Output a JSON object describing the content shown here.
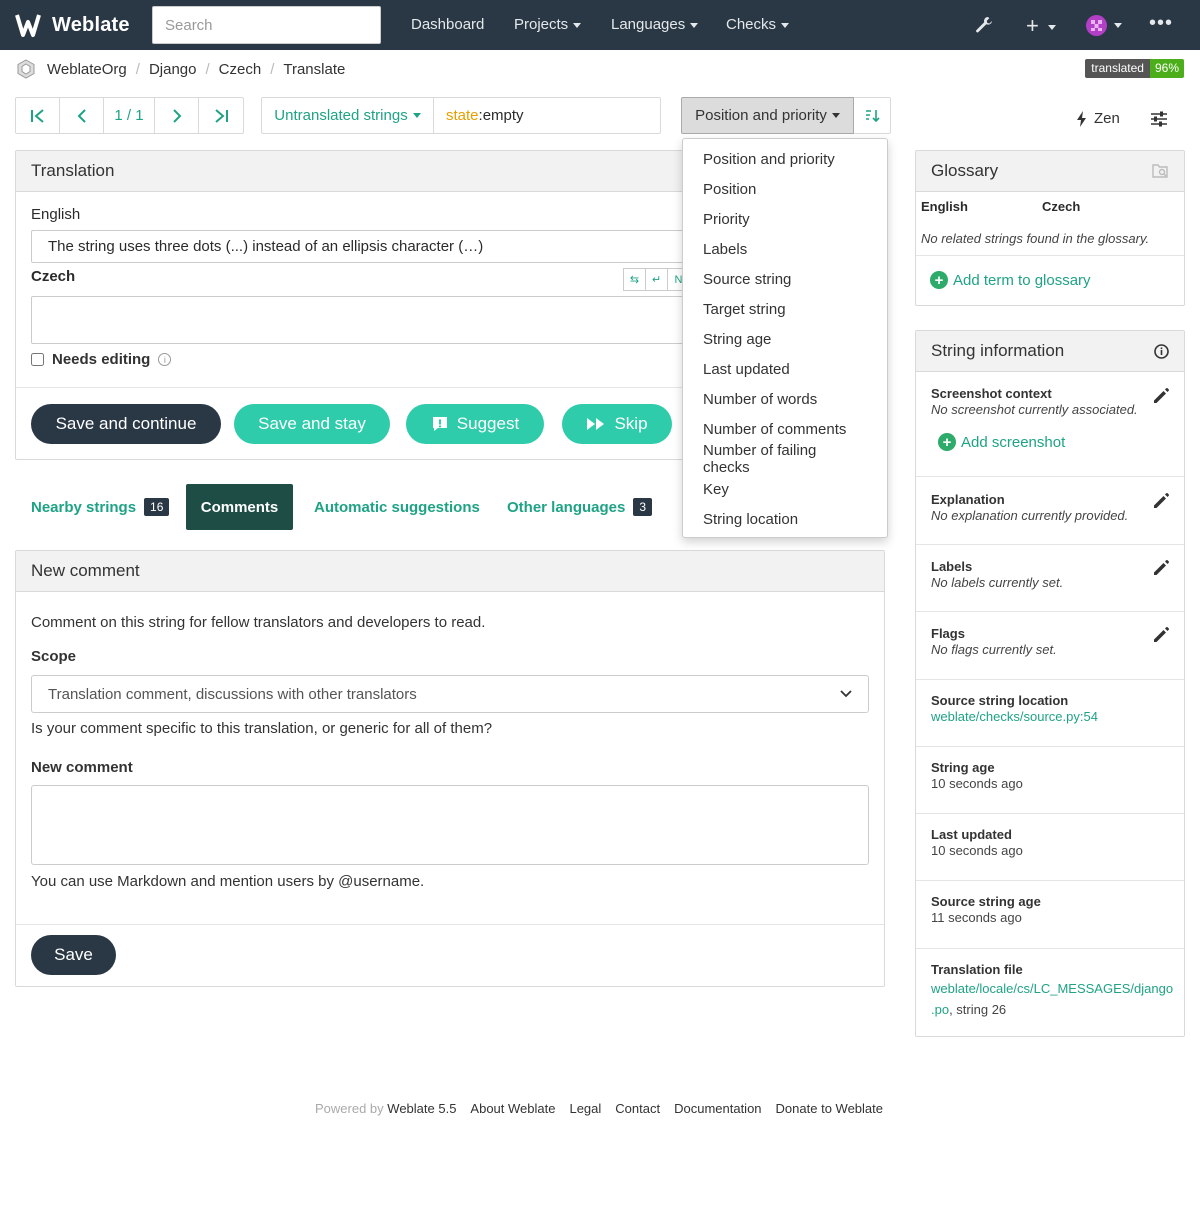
{
  "navbar": {
    "brand": "Weblate",
    "search_placeholder": "Search",
    "links": [
      "Dashboard",
      "Projects",
      "Languages",
      "Checks"
    ]
  },
  "breadcrumb": [
    "WeblateOrg",
    "Django",
    "Czech",
    "Translate"
  ],
  "badge": {
    "label": "translated",
    "value": "96%"
  },
  "pager": {
    "count": "1 / 1"
  },
  "filter": {
    "label": "Untranslated strings",
    "query_key": "state",
    "query_value": ":empty"
  },
  "sort": {
    "label": "Position and priority"
  },
  "zen_label": "Zen",
  "translation": {
    "title": "Translation",
    "source_lang": "English",
    "source_text": "The string uses three dots (...) instead of an ellipsis character (…)",
    "target_lang": "Czech",
    "tool_n": "N",
    "needs_editing": "Needs editing",
    "buttons": {
      "save_continue": "Save and continue",
      "save_stay": "Save and stay",
      "suggest": "Suggest",
      "skip": "Skip"
    }
  },
  "tabs": [
    {
      "label": "Nearby strings",
      "count": "16"
    },
    {
      "label": "Comments"
    },
    {
      "label": "Automatic suggestions"
    },
    {
      "label": "Other languages",
      "count": "3"
    }
  ],
  "comment": {
    "title": "New comment",
    "intro": "Comment on this string for fellow translators and developers to read.",
    "scope_label": "Scope",
    "scope_value": "Translation comment, discussions with other translators",
    "scope_help": "Is your comment specific to this translation, or generic for all of them?",
    "comment_label": "New comment",
    "markdown_help": "You can use Markdown and mention users by @username.",
    "save": "Save"
  },
  "sort_menu": [
    "Position and priority",
    "Position",
    "Priority",
    "Labels",
    "Source string",
    "Target string",
    "String age",
    "Last updated",
    "Number of words",
    "Number of comments",
    "Number of failing checks",
    "Key",
    "String location"
  ],
  "glossary": {
    "title": "Glossary",
    "col_source": "English",
    "col_target": "Czech",
    "empty": "No related strings found in the glossary.",
    "add": "Add term to glossary"
  },
  "string_info": {
    "title": "String information",
    "screenshot_title": "Screenshot context",
    "screenshot_value": "No screenshot currently associated.",
    "add_screenshot": "Add screenshot",
    "explanation_title": "Explanation",
    "explanation_value": "No explanation currently provided.",
    "labels_title": "Labels",
    "labels_value": "No labels currently set.",
    "flags_title": "Flags",
    "flags_value": "No flags currently set.",
    "location_title": "Source string location",
    "location_value": "weblate/checks/source.py:54",
    "age_title": "String age",
    "age_value": "10 seconds ago",
    "updated_title": "Last updated",
    "updated_value": "10 seconds ago",
    "source_age_title": "Source string age",
    "source_age_value": "11 seconds ago",
    "file_title": "Translation file",
    "file_link_1": "weblate/locale/cs/LC_MESSAGES/django",
    "file_link_2": ".po",
    "file_suffix": ", string 26"
  },
  "footer": {
    "powered_by": "Powered by",
    "version": "Weblate 5.5",
    "links": [
      "About Weblate",
      "Legal",
      "Contact",
      "Documentation",
      "Donate to Weblate"
    ]
  },
  "colors": {
    "navbar": "#2a3744",
    "accent": "#1fa385",
    "button_teal": "#2eccaa",
    "active_tab": "#1d4d44"
  }
}
